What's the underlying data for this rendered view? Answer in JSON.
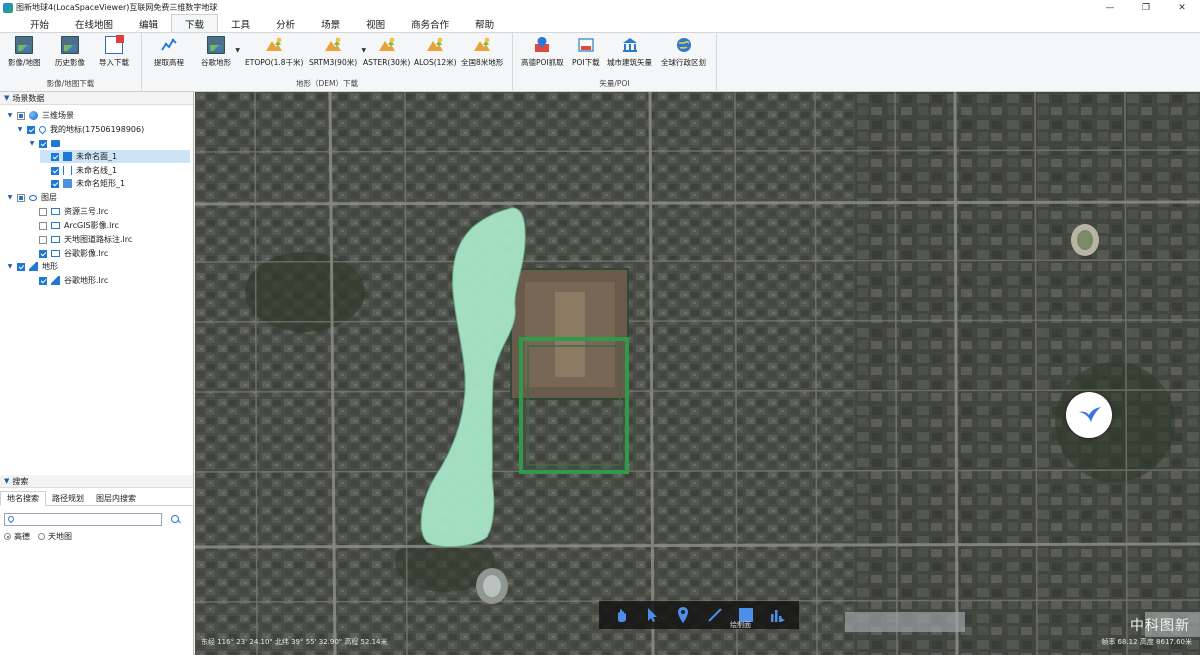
{
  "window": {
    "title": "图新地球4(LocaSpaceViewer)互联网免费三维数字地球",
    "minimize": "—",
    "maximize": "❐",
    "close": "✕"
  },
  "menu": {
    "tabs": [
      {
        "label": "开始"
      },
      {
        "label": "在线地图"
      },
      {
        "label": "编辑"
      },
      {
        "label": "下载",
        "active": true
      },
      {
        "label": "工具"
      },
      {
        "label": "分析"
      },
      {
        "label": "场景"
      },
      {
        "label": "视图"
      },
      {
        "label": "商务合作"
      },
      {
        "label": "帮助"
      }
    ]
  },
  "ribbon": {
    "groups": [
      {
        "title": "影像/地图下载",
        "buttons": [
          "影像/地图",
          "历史影像",
          "导入下载"
        ]
      },
      {
        "title": "地形（DEM）下载",
        "buttons": [
          "提取高程",
          "谷歌地形",
          "ETOPO(1.8千米)",
          "SRTM3(90米)",
          "ASTER(30米)",
          "ALOS(12米)",
          "全国8米地形"
        ]
      },
      {
        "title": "矢量/POI",
        "buttons": [
          "高德POI抓取",
          "POI下载",
          "城市建筑矢量",
          "全球行政区划"
        ]
      }
    ]
  },
  "scene_panel": {
    "title": "场景数据",
    "tree": {
      "root": "三维场景",
      "myplace": "我的地标(17506198906)",
      "items": [
        "未命名面_1",
        "未命名线_1",
        "未命名矩形_1"
      ],
      "layers_group": "图层",
      "layers": [
        "资源三号.lrc",
        "ArcGIS影像.lrc",
        "天地图道路标注.lrc",
        "谷歌影像.lrc"
      ],
      "terrain_group": "地形",
      "terrain": [
        "谷歌地形.lrc"
      ]
    }
  },
  "search_panel": {
    "title": "搜索",
    "tabs": [
      "地名搜索",
      "路径规划",
      "图层内搜索"
    ],
    "query": "",
    "providers": [
      "高德",
      "天地图"
    ],
    "selected_provider": "高德"
  },
  "map": {
    "toolbar_label": "绘制面",
    "status_left": "东经 116° 23' 24.10\" 北纬 39° 55' 32.90\" 高程 52.14米",
    "status_right": "帧率 68.12  高度 8617.60米",
    "watermark": "中科图新"
  },
  "colors": {
    "accent": "#1e78d7",
    "polygon_fill": "#a8e6c8",
    "rect_outline": "#2e9a4a"
  }
}
